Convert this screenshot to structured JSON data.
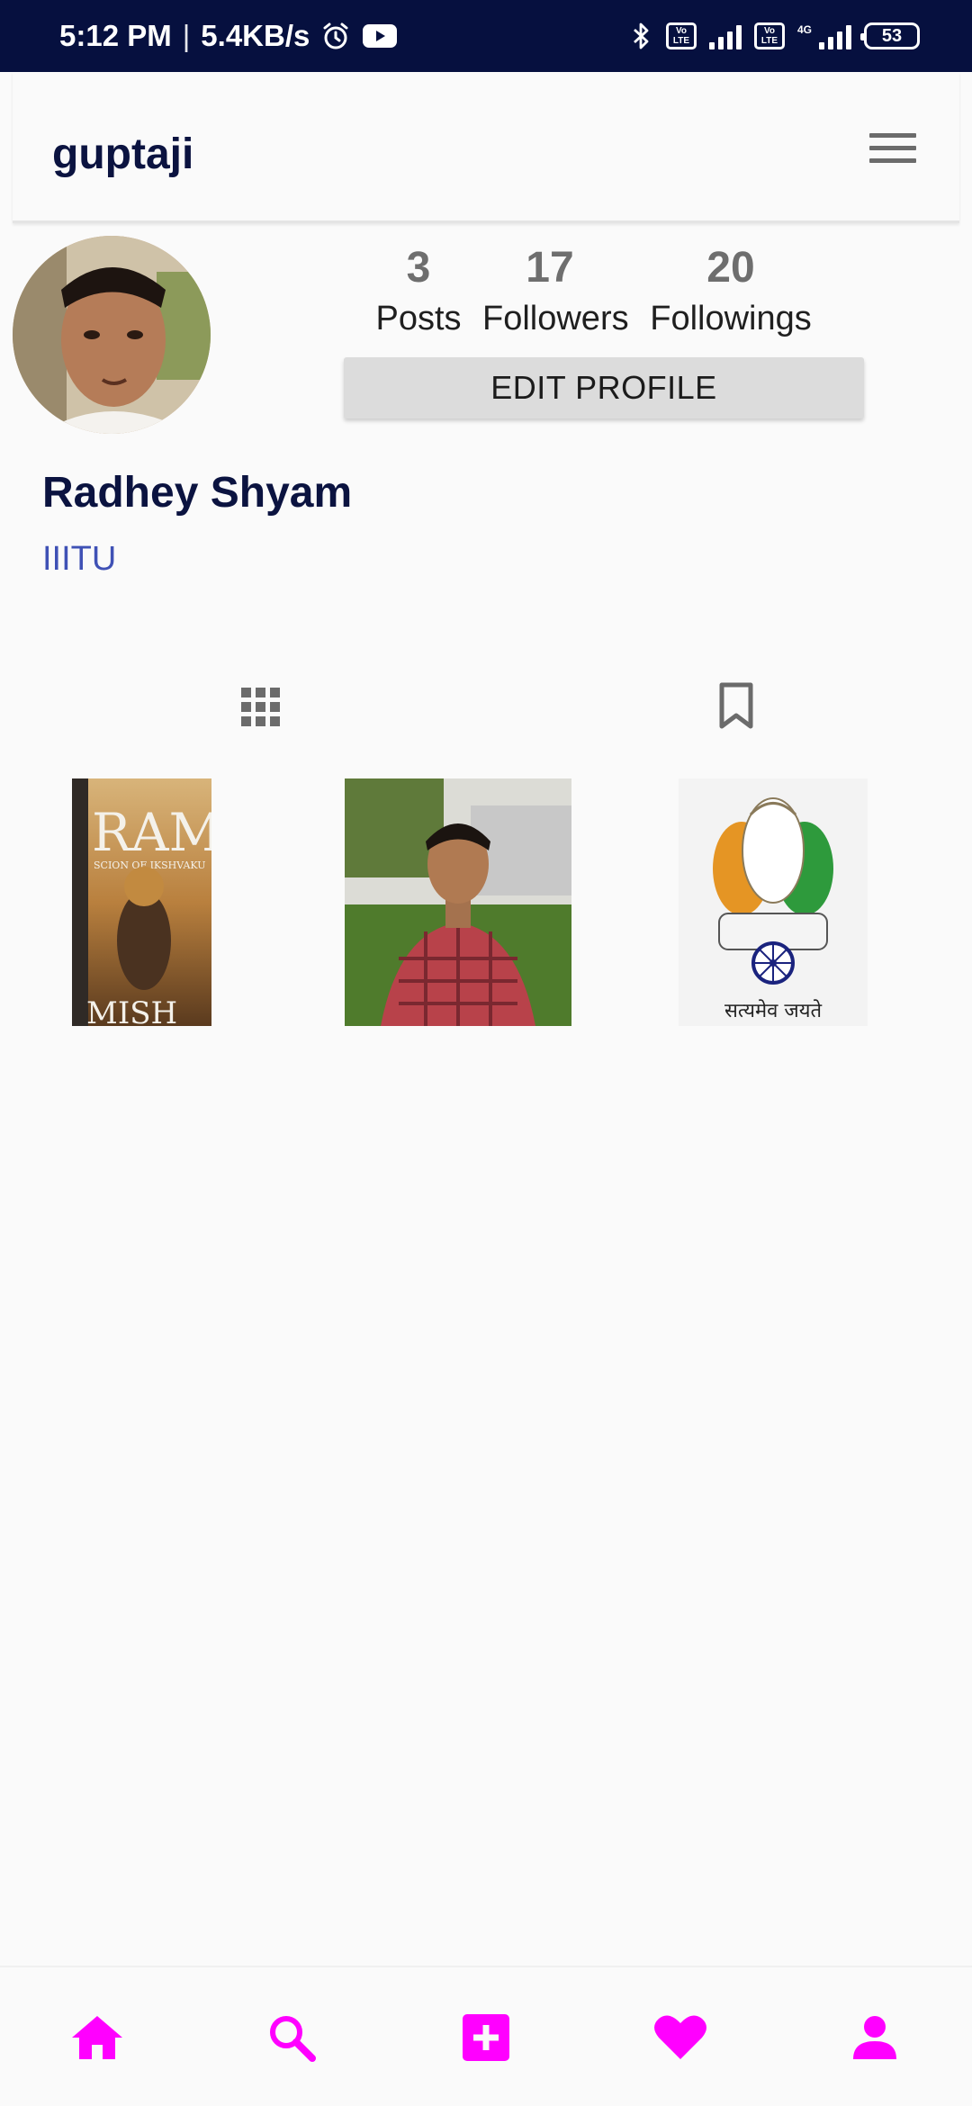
{
  "status_bar": {
    "time": "5:12 PM",
    "separator": "|",
    "speed": "5.4KB/s",
    "volte_1": "Vo\nLTE",
    "volte_2": "Vo\nLTE",
    "network": "4G",
    "battery": "53",
    "icons": [
      "alarm-icon",
      "youtube-icon",
      "bluetooth-icon",
      "volte-icon",
      "signal-icon",
      "volte-icon",
      "signal-icon",
      "battery-icon"
    ]
  },
  "header": {
    "title": "guptaji",
    "menu_icon": "hamburger-menu-icon"
  },
  "profile": {
    "stats": [
      {
        "value": "3",
        "label": "Posts"
      },
      {
        "value": "17",
        "label": "Followers"
      },
      {
        "value": "20",
        "label": "Followings"
      }
    ],
    "edit_button": "EDIT PROFILE",
    "name": "Radhey Shyam",
    "bio": "IIITU"
  },
  "tabs": [
    {
      "icon": "grid-icon"
    },
    {
      "icon": "bookmark-icon"
    }
  ],
  "posts": [
    {
      "kind": "book-cover-photo",
      "cover_title": "RAM",
      "cover_subtitle": "SCION OF IKSHVAKU",
      "cover_author": "MISH"
    },
    {
      "kind": "person-photo"
    },
    {
      "kind": "national-emblem-photo",
      "caption": "सत्यमेव जयते"
    }
  ],
  "bottom_nav": [
    {
      "icon": "home-icon"
    },
    {
      "icon": "search-icon"
    },
    {
      "icon": "add-post-icon"
    },
    {
      "icon": "heart-icon"
    },
    {
      "icon": "profile-icon"
    }
  ],
  "colors": {
    "status_bar_bg": "#06103f",
    "title_color": "#0b1340",
    "bio_color": "#3f51b5",
    "nav_accent": "#ff00ff",
    "stat_number": "#6e6e6e"
  }
}
